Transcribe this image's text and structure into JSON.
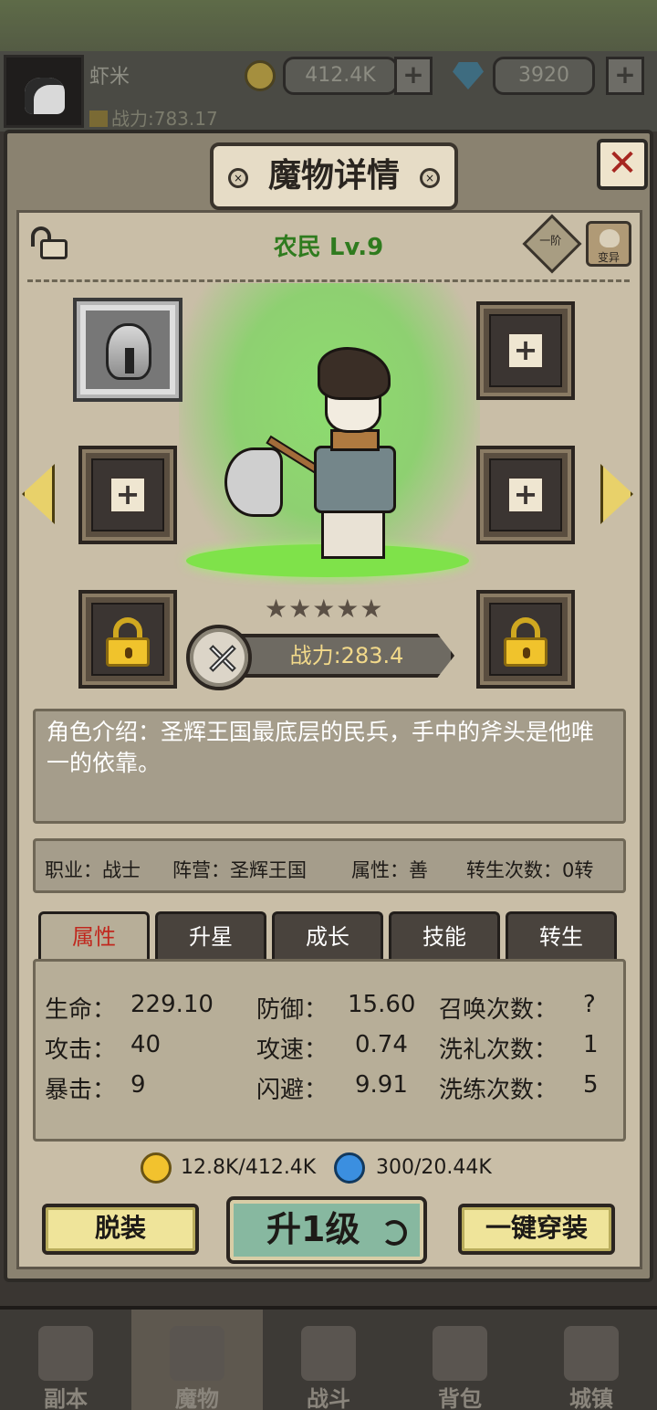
{
  "hud": {
    "player_name": "虾米",
    "power": "战力:783.17",
    "gold": "412.4K",
    "gems": "3920"
  },
  "panel": {
    "title": "魔物详情",
    "unit_name": "农民 Lv.9",
    "tier": "一阶",
    "mutate": "变异",
    "stars": "★★★★★",
    "power": "战力:283.4",
    "description": "角色介绍：圣辉王国最底层的民兵，手中的斧头是他唯一的依靠。",
    "info": {
      "class": "职业：战士",
      "faction": "阵营：圣辉王国",
      "alignment": "属性：善",
      "rebirths": "转生次数：0转"
    },
    "tabs": [
      "属性",
      "升星",
      "成长",
      "技能",
      "转生"
    ],
    "stats": {
      "hp_label": "生命：",
      "hp": "229.10",
      "def_label": "防御：",
      "def": "15.60",
      "summon_label": "召唤次数：",
      "summon": "?",
      "atk_label": "攻击：",
      "atk": "40",
      "spd_label": "攻速：",
      "spd": "0.74",
      "baptism_label": "洗礼次数：",
      "baptism": "1",
      "crit_label": "暴击：",
      "crit": "9",
      "dodge_label": "闪避：",
      "dodge": "9.91",
      "refine_label": "洗练次数：",
      "refine": "5"
    },
    "cost_gold": "12.8K/412.4K",
    "cost_exp": "300/20.44K",
    "unequip_label": "脱装",
    "levelup_label": "升1级",
    "equip_all_label": "一键穿装"
  },
  "nav": [
    "副本",
    "魔物",
    "战斗",
    "背包",
    "城镇"
  ],
  "colors": {
    "unit_name": "#2f7b1e",
    "active_tab": "#c0281e",
    "spotlight": "#8ddc6f"
  }
}
